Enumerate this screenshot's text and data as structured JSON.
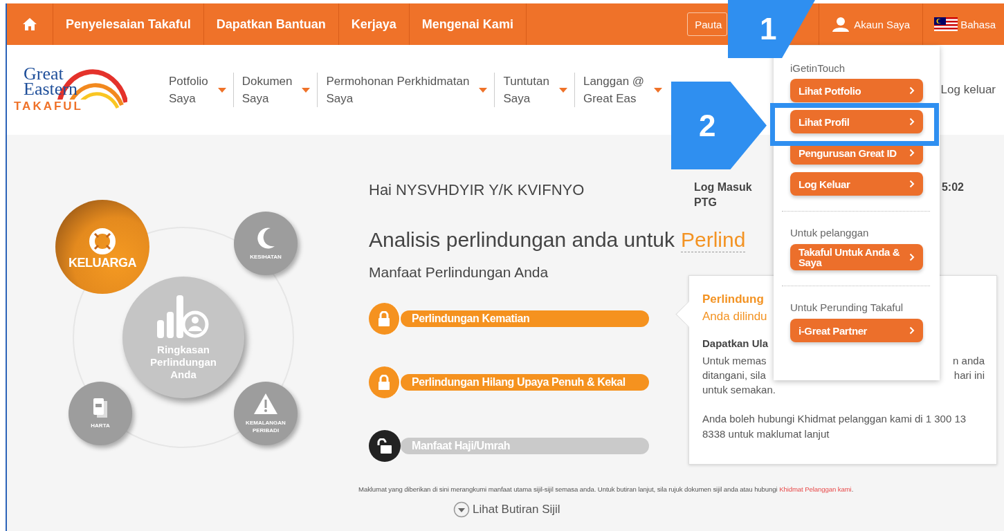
{
  "top_nav": {
    "items": [
      {
        "label": "Penyelesaian Takaful"
      },
      {
        "label": "Dapatkan Bantuan"
      },
      {
        "label": "Kerjaya"
      },
      {
        "label": "Mengenai Kami"
      }
    ],
    "login_button": "Pauta",
    "account": "Akaun Saya",
    "language": "Bahasa"
  },
  "logo": {
    "line_1": "Great",
    "line_2": "Eastern",
    "line_3": "TAKAFUL"
  },
  "main_menu": [
    {
      "line_1": "Potfolio",
      "line_2": "Saya"
    },
    {
      "line_1": "Dokumen",
      "line_2": "Saya"
    },
    {
      "line_1": "Permohonan Perkhidmatan",
      "line_2": "Saya"
    },
    {
      "line_1": "Tuntutan",
      "line_2": "Saya"
    },
    {
      "line_1": "Langgan @",
      "line_2": "Great Eas"
    }
  ],
  "logout": "Log keluar",
  "diagram": {
    "center": "Ringkasan Perlindungan Anda",
    "segments": [
      {
        "label": "KELUARGA",
        "selected": true
      },
      {
        "label": "KESIHATAN",
        "selected": false
      },
      {
        "label": "HARTA",
        "selected": false
      },
      {
        "label": "KEMALANGAN PERIBADI",
        "selected": false
      }
    ]
  },
  "greeting": "Hai NYSVHDYIR Y/K KVIFNYO",
  "login_info": {
    "label": "Log Masuk",
    "time": "5:02",
    "period": "PTG"
  },
  "analysis": {
    "heading": "Analisis perlindungan anda untuk",
    "category": "Perlind"
  },
  "subheading": "Manfaat Perlindungan Anda",
  "benefits": [
    {
      "label": "Perlindungan Kematian",
      "covered": true
    },
    {
      "label": "Perlindungan Hilang Upaya Penuh & Kekal",
      "covered": true
    },
    {
      "label": "Manfaat Haji/Umrah",
      "covered": false
    }
  ],
  "popover": {
    "title": "Perlindung",
    "subtitle": "Anda dilindu",
    "section": "Dapatkan Ula",
    "lines": [
      {
        "left": "Untuk memas",
        "right": "n anda"
      },
      {
        "left": "ditangani, sila",
        "right": "hari ini"
      },
      {
        "left": "untuk semakan."
      }
    ],
    "contact": "Anda boleh hubungi Khidmat pelanggan kami di 1 300 13 8338 untuk maklumat lanjut"
  },
  "dropdown": {
    "sections": [
      {
        "heading": "iGetinTouch",
        "items": [
          {
            "label": "Lihat Potfolio"
          },
          {
            "label": "Lihat Profil"
          },
          {
            "label": "Pengurusan Great ID"
          },
          {
            "label": "Log Keluar"
          }
        ]
      },
      {
        "heading": "Untuk pelanggan",
        "items": [
          {
            "label": "Takaful Untuk Anda & Saya"
          }
        ]
      },
      {
        "heading": "Untuk Perunding Takaful",
        "items": [
          {
            "label": "i-Great Partner"
          }
        ]
      }
    ]
  },
  "footnote": {
    "text": "Maklumat yang diberikan di sini merangkumi manfaat utama sijil-sijil semasa anda. Untuk butiran lanjut, sila rujuk dokumen sijil anda atau hubungi",
    "link": "Khidmat Pelanggan kami",
    "end": "."
  },
  "details_toggle": "Lihat Butiran Sijil",
  "callouts": [
    {
      "number": "1"
    },
    {
      "number": "2"
    }
  ]
}
